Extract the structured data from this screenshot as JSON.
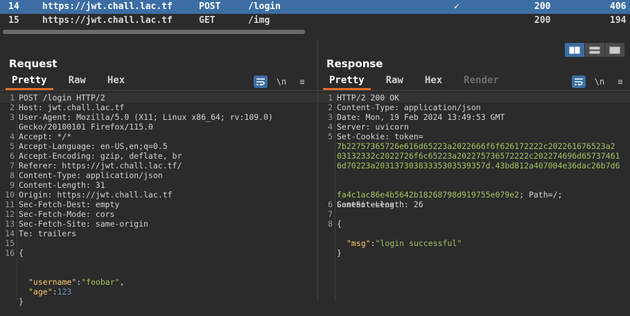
{
  "history": {
    "rows": [
      {
        "num": "14",
        "host": "https://jwt.chall.lac.tf",
        "method": "POST",
        "path": "/login",
        "check": "✓",
        "status": "200",
        "length": "406",
        "selected": true
      },
      {
        "num": "15",
        "host": "https://jwt.chall.lac.tf",
        "method": "GET",
        "path": "/img",
        "check": "",
        "status": "200",
        "length": "194",
        "selected": false
      }
    ]
  },
  "request": {
    "title": "Request",
    "tabs": [
      "Pretty",
      "Raw",
      "Hex"
    ],
    "active_tab": "Pretty",
    "lines": [
      {
        "n": "1",
        "t": "POST /login HTTP/2"
      },
      {
        "n": "2",
        "t": "Host: jwt.chall.lac.tf"
      },
      {
        "n": "3",
        "t": "User-Agent: Mozilla/5.0 (X11; Linux x86_64; rv:109.0)"
      },
      {
        "n": "",
        "t": "Gecko/20100101 Firefox/115.0"
      },
      {
        "n": "4",
        "t": "Accept: */*"
      },
      {
        "n": "5",
        "t": "Accept-Language: en-US,en;q=0.5"
      },
      {
        "n": "6",
        "t": "Accept-Encoding: gzip, deflate, br"
      },
      {
        "n": "7",
        "t": "Referer: https://jwt.chall.lac.tf/"
      },
      {
        "n": "8",
        "t": "Content-Type: application/json"
      },
      {
        "n": "9",
        "t": "Content-Length: 31"
      },
      {
        "n": "10",
        "t": "Origin: https://jwt.chall.lac.tf"
      },
      {
        "n": "11",
        "t": "Sec-Fetch-Dest: empty"
      },
      {
        "n": "12",
        "t": "Sec-Fetch-Mode: cors"
      },
      {
        "n": "13",
        "t": "Sec-Fetch-Site: same-origin"
      },
      {
        "n": "14",
        "t": "Te: trailers"
      },
      {
        "n": "15",
        "t": ""
      },
      {
        "n": "16",
        "t": "{"
      }
    ],
    "body": {
      "username_key": "\"username\"",
      "username_val": "\"foobar\"",
      "age_key": "\"age\"",
      "age_val": "123",
      "close": "}"
    }
  },
  "response": {
    "title": "Response",
    "tabs": [
      "Pretty",
      "Raw",
      "Hex",
      "Render"
    ],
    "active_tab": "Pretty",
    "lines": [
      {
        "n": "1",
        "t": "HTTP/2 200 OK"
      },
      {
        "n": "2",
        "t": "Content-Type: application/json"
      },
      {
        "n": "3",
        "t": "Date: Mon, 19 Feb 2024 13:49:53 GMT"
      },
      {
        "n": "4",
        "t": "Server: uvicorn"
      },
      {
        "n": "5",
        "t": "Set-Cookie: token="
      }
    ],
    "cookie_lines": [
      "7b22757365726e616d65223a2022666f6f626172222c202261676523a2",
      "03132332c2022726f6c65223a202275736572222c202274696d65737461",
      "6d70223a20313730383335303539357d.43bd812a407004e36dac26b7d6",
      "fa4c1ac86e4b5642b18268798d919755e079e2"
    ],
    "cookie_suffix": "; Path=/;",
    "samesite": "SameSite=lax",
    "after": [
      {
        "n": "6",
        "t": "Content-Length: 26"
      },
      {
        "n": "7",
        "t": ""
      },
      {
        "n": "8",
        "t": "{"
      }
    ],
    "body": {
      "msg_key": "\"msg\"",
      "msg_val": "\"login successful\"",
      "close": "}"
    }
  },
  "toolbar": {
    "newline_label": "\\n",
    "menu_label": "≡"
  },
  "colors": {
    "accent": "#3c6ea5",
    "tab_underline": "#e06b2b",
    "json_key": "#ffc66d",
    "json_string": "#a5c25c",
    "json_number": "#6897bb"
  }
}
